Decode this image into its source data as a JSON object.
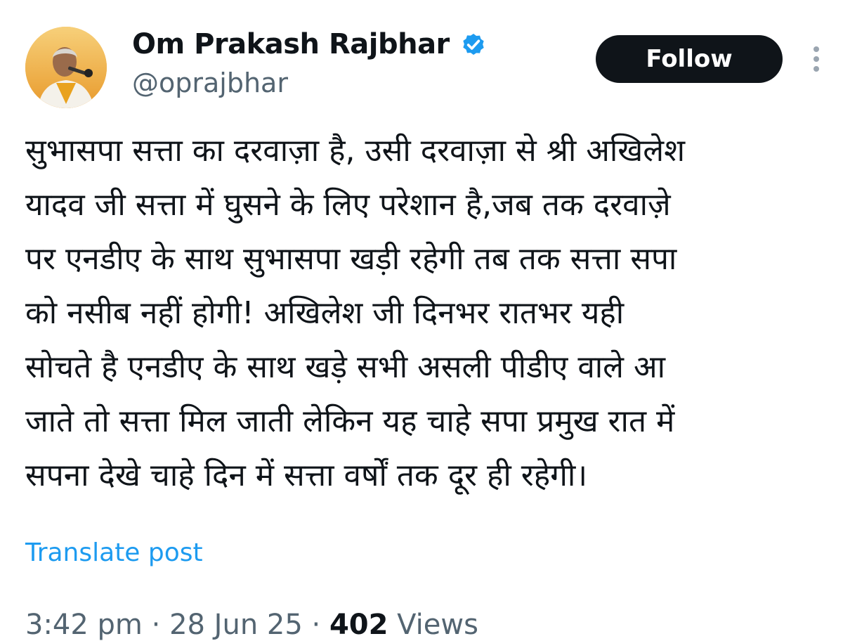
{
  "user": {
    "display_name": "Om Prakash Rajbhar",
    "handle": "@oprajbhar",
    "verified": true
  },
  "actions": {
    "follow_label": "Follow"
  },
  "tweet": {
    "text": "सुभासपा सत्ता का दरवाज़ा है, उसी दरवाज़ा से श्री अखिलेश\nयादव जी सत्ता में घुसने के लिए परेशान है,जब तक दरवाज़े\nपर एनडीए के साथ सुभासपा खड़ी रहेगी तब तक सत्ता सपा\nको नसीब नहीं होगी! अखिलेश जी दिनभर रातभर यही\nसोचते है एनडीए के साथ खड़े सभी असली पीडीए वाले आ\nजाते तो सत्ता मिल जाती लेकिन यह चाहे सपा प्रमुख रात में\nसपना देखे चाहे दिन में सत्ता वर्षों तक दूर ही रहेगी।",
    "translate_label": "Translate post"
  },
  "meta": {
    "time": "3:42 pm",
    "separator": " · ",
    "date": "28 Jun 25",
    "views_count": "402",
    "views_label": " Views"
  },
  "colors": {
    "link_blue": "#1d9bf0",
    "text_primary": "#0f1419",
    "text_secondary": "#536471",
    "button_bg": "#0f1419"
  },
  "icons": {
    "verified": "verified-badge-icon",
    "more": "more-vertical-icon"
  }
}
